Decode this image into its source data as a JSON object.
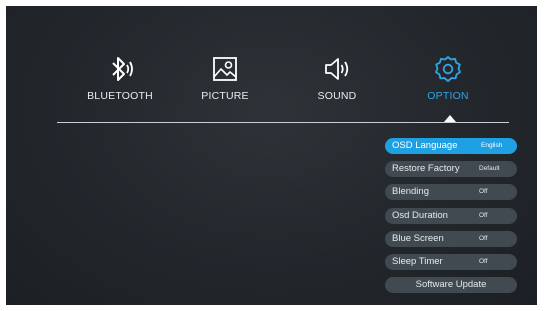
{
  "menu": [
    {
      "label": "BLUETOOTH",
      "icon": "bluetooth-icon",
      "active": false
    },
    {
      "label": "PICTURE",
      "icon": "picture-icon",
      "active": false
    },
    {
      "label": "SOUND",
      "icon": "speaker-icon",
      "active": false
    },
    {
      "label": "OPTION",
      "icon": "gear-icon",
      "active": true
    }
  ],
  "options": [
    {
      "label": "OSD Language",
      "value": "English",
      "selected": true
    },
    {
      "label": "Restore Factory",
      "value": "Default"
    },
    {
      "label": "Blending",
      "value": "Off"
    },
    {
      "label": "Osd Duration",
      "value": "Off"
    },
    {
      "label": "Blue Screen",
      "value": "Off"
    },
    {
      "label": "Sleep Timer",
      "value": "Off"
    }
  ],
  "software_update": "Software Update",
  "colors": {
    "accent": "#2ea6e6",
    "background": "#23272c",
    "row": "#414951"
  }
}
